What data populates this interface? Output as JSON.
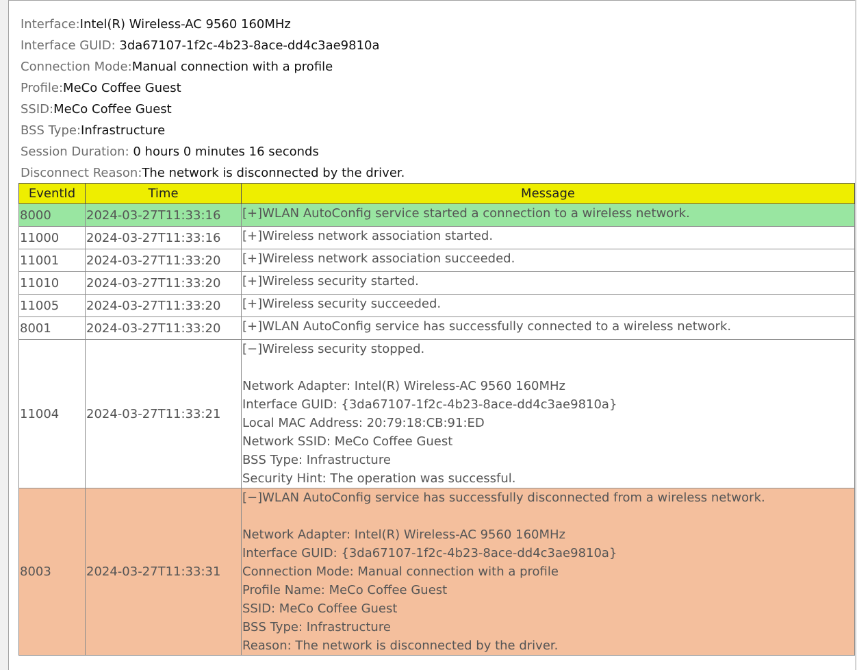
{
  "summary": {
    "interface_label": "Interface:",
    "interface_value": "Intel(R) Wireless-AC 9560 160MHz",
    "guid_label": "Interface GUID: ",
    "guid_value": "3da67107-1f2c-4b23-8ace-dd4c3ae9810a",
    "mode_label": "Connection Mode:",
    "mode_value": "Manual connection with a profile",
    "profile_label": "Profile:",
    "profile_value": "MeCo Coffee Guest",
    "ssid_label": "SSID:",
    "ssid_value": "MeCo Coffee Guest",
    "bss_label": "BSS Type:",
    "bss_value": "Infrastructure",
    "duration_label": "Session Duration: ",
    "duration_value": "0 hours 0 minutes 16 seconds",
    "reason_label": "Disconnect Reason:",
    "reason_value": "The network is disconnected by the driver."
  },
  "table": {
    "headers": [
      "EventId",
      "Time",
      "Message"
    ],
    "rows": [
      {
        "id": "8000",
        "time": "2024-03-27T11:33:16",
        "lines": [
          "[+]WLAN AutoConfig service started a connection to a wireless network."
        ]
      },
      {
        "id": "11000",
        "time": "2024-03-27T11:33:16",
        "lines": [
          "[+]Wireless network association started."
        ]
      },
      {
        "id": "11001",
        "time": "2024-03-27T11:33:20",
        "lines": [
          "[+]Wireless network association succeeded."
        ]
      },
      {
        "id": "11010",
        "time": "2024-03-27T11:33:20",
        "lines": [
          "[+]Wireless security started."
        ]
      },
      {
        "id": "11005",
        "time": "2024-03-27T11:33:20",
        "lines": [
          "[+]Wireless security succeeded."
        ]
      },
      {
        "id": "8001",
        "time": "2024-03-27T11:33:20",
        "lines": [
          "[+]WLAN AutoConfig service has successfully connected to a wireless network."
        ]
      },
      {
        "id": "11004",
        "time": "2024-03-27T11:33:21",
        "lines": [
          "[−]Wireless security stopped.",
          "",
          "Network Adapter: Intel(R) Wireless-AC 9560 160MHz",
          "Interface GUID: {3da67107-1f2c-4b23-8ace-dd4c3ae9810a}",
          "Local MAC Address: 20:79:18:CB:91:ED",
          "Network SSID: MeCo Coffee Guest",
          "BSS Type: Infrastructure",
          "Security Hint: The operation was successful."
        ]
      },
      {
        "id": "8003",
        "time": "2024-03-27T11:33:31",
        "lines": [
          "[−]WLAN AutoConfig service has successfully disconnected from a wireless network.",
          "",
          "Network Adapter: Intel(R) Wireless-AC 9560 160MHz",
          "Interface GUID: {3da67107-1f2c-4b23-8ace-dd4c3ae9810a}",
          "Connection Mode: Manual connection with a profile",
          "Profile Name: MeCo Coffee Guest",
          "SSID: MeCo Coffee Guest",
          "BSS Type: Infrastructure",
          "Reason: The network is disconnected by the driver."
        ]
      }
    ]
  },
  "colors": {
    "header_bg": "#eeee00",
    "connect_start_bg": "#99e6a1",
    "disconnect_bg": "#f4bf9d"
  }
}
